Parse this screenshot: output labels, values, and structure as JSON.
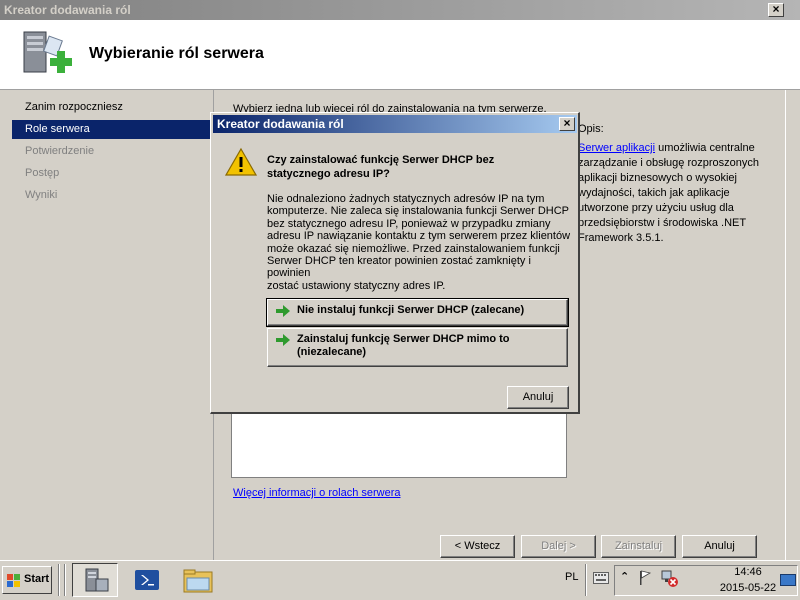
{
  "wizard": {
    "title": "Kreator dodawania ról",
    "header_title": "Wybieranie ról serwera",
    "nav": [
      {
        "label": "Zanim rozpoczniesz",
        "state": "done"
      },
      {
        "label": "Role serwera",
        "state": "selected"
      },
      {
        "label": "Potwierdzenie",
        "state": "disabled"
      },
      {
        "label": "Postęp",
        "state": "disabled"
      },
      {
        "label": "Wyniki",
        "state": "disabled"
      }
    ],
    "content_intro": "Wybierz jedną lub więcej ról do zainstalowania na tym serwerze.",
    "description_heading": "Opis:",
    "description_link": "Serwer aplikacji",
    "description_lines": [
      "umożliwia centralne",
      "zarządzanie i obsługę rozproszonych",
      "aplikacji biznesowych o wysokiej",
      "wydajności, takich jak aplikacje",
      "utworzone przy użyciu usług dla",
      "przedsiębiorstw i środowiska .NET",
      "Framework 3.5.1."
    ],
    "more_info_link": "Więcej informacji o rolach serwera",
    "buttons": {
      "back": "< Wstecz",
      "next": "Dalej >",
      "install": "Zainstaluj",
      "cancel": "Anuluj"
    }
  },
  "dialog": {
    "title": "Kreator dodawania ról",
    "question": "Czy zainstalować funkcję Serwer DHCP bez statycznego adresu IP?",
    "body_lines": [
      "Nie odnaleziono żadnych statycznych adresów IP na tym",
      "komputerze. Nie zaleca się instalowania funkcji Serwer DHCP",
      "bez statycznego adresu IP, ponieważ w przypadku zmiany",
      "adresu IP nawiązanie kontaktu z tym serwerem przez klientów",
      "może okazać się niemożliwe. Przed zainstalowaniem funkcji",
      "Serwer DHCP ten kreator powinien zostać zamknięty i powinien",
      "zostać ustawiony statyczny adres IP."
    ],
    "option1": "Nie instaluj funkcji Serwer DHCP (zalecane)",
    "option2_line1": "Zainstaluj funkcję Serwer DHCP mimo to",
    "option2_line2": "(niezalecane)",
    "cancel": "Anuluj"
  },
  "taskbar": {
    "start": "Start",
    "language": "PL",
    "time": "14:46",
    "date": "2015-05-22"
  },
  "colors": {
    "selection": "#0a246a",
    "link": "#0000ff",
    "command_arrow": "#2e9a2e",
    "warning": "#f2c200"
  }
}
